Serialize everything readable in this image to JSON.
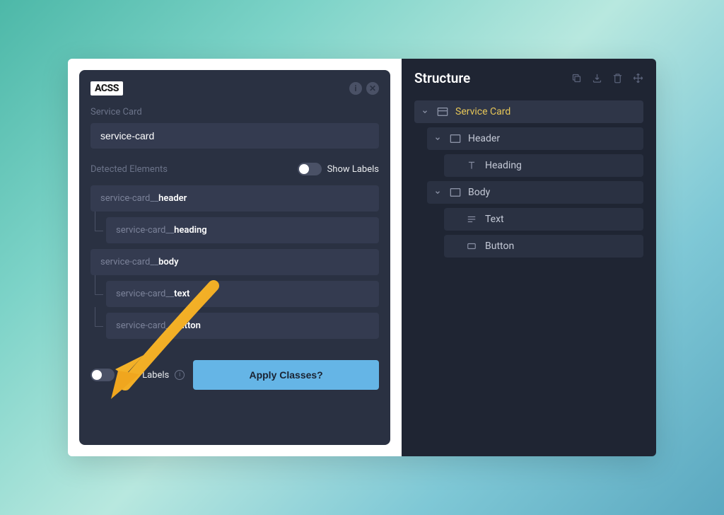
{
  "acss": {
    "logo": "ACSS",
    "service_card_label": "Service Card",
    "class_name_value": "service-card",
    "detected_elements_label": "Detected Elements",
    "show_labels_text": "Show Labels",
    "elements": [
      {
        "prefix": "service-card__",
        "suffix": "header",
        "nested": false
      },
      {
        "prefix": "service-card__",
        "suffix": "heading",
        "nested": true
      },
      {
        "prefix": "service-card__",
        "suffix": "body",
        "nested": false
      },
      {
        "prefix": "service-card__",
        "suffix": "text",
        "nested": true
      },
      {
        "prefix": "service-card__",
        "suffix": "button",
        "nested": true
      }
    ],
    "sync_labels_text": "Sync Labels",
    "apply_button_label": "Apply Classes?"
  },
  "structure": {
    "title": "Structure",
    "tree": [
      {
        "label": "Service Card",
        "icon": "container",
        "indent": 0,
        "chevron": true,
        "selected": true
      },
      {
        "label": "Header",
        "icon": "container",
        "indent": 1,
        "chevron": true,
        "selected": false
      },
      {
        "label": "Heading",
        "icon": "text-t",
        "indent": 2,
        "chevron": false,
        "selected": false
      },
      {
        "label": "Body",
        "icon": "container",
        "indent": 1,
        "chevron": true,
        "selected": false
      },
      {
        "label": "Text",
        "icon": "lines",
        "indent": 2,
        "chevron": false,
        "selected": false
      },
      {
        "label": "Button",
        "icon": "box",
        "indent": 2,
        "chevron": false,
        "selected": false
      }
    ]
  }
}
